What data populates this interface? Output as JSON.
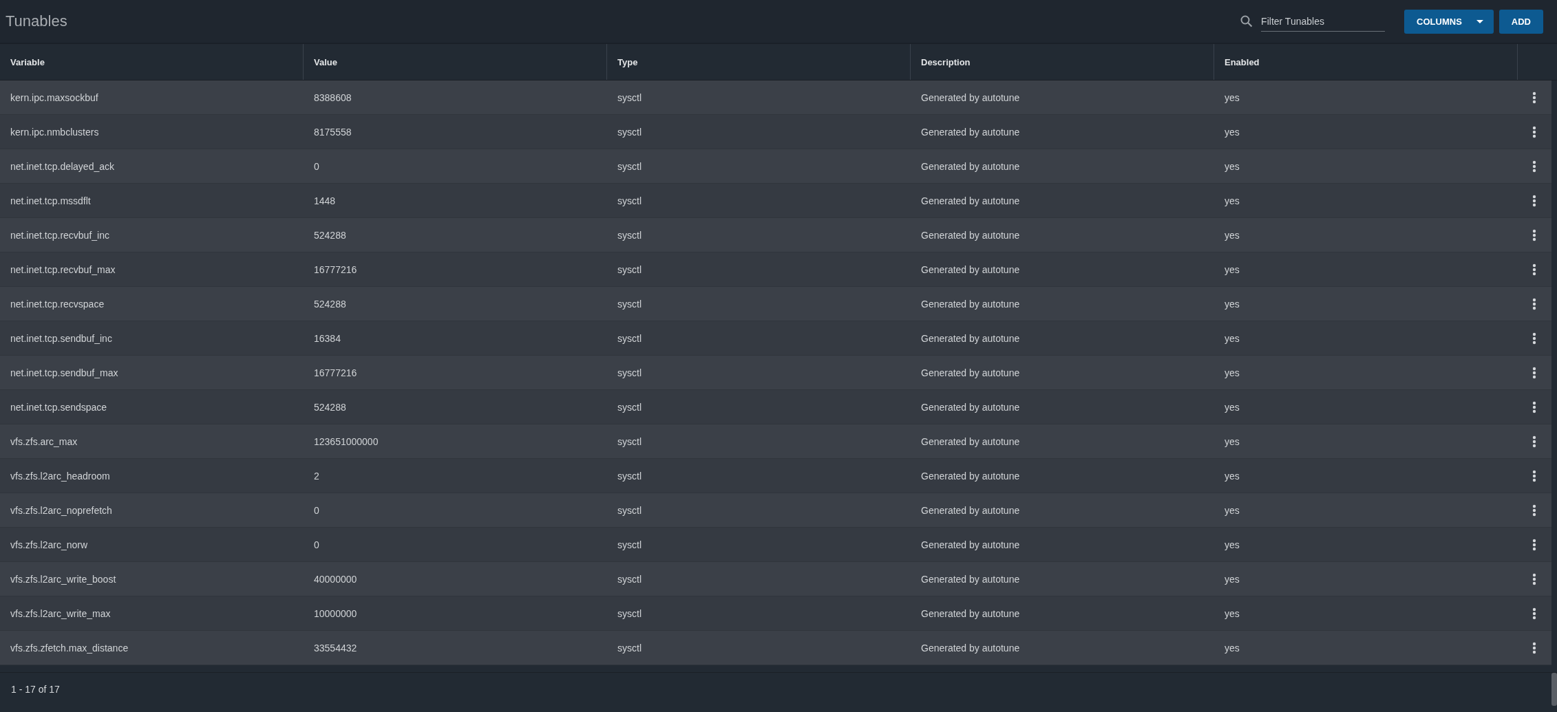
{
  "page_title": "Tunables",
  "filter": {
    "placeholder": "Filter Tunables"
  },
  "buttons": {
    "columns": "COLUMNS",
    "add": "ADD"
  },
  "table": {
    "columns": [
      "Variable",
      "Value",
      "Type",
      "Description",
      "Enabled"
    ],
    "rows": [
      [
        "kern.ipc.maxsockbuf",
        "8388608",
        "sysctl",
        "Generated by autotune",
        "yes"
      ],
      [
        "kern.ipc.nmbclusters",
        "8175558",
        "sysctl",
        "Generated by autotune",
        "yes"
      ],
      [
        "net.inet.tcp.delayed_ack",
        "0",
        "sysctl",
        "Generated by autotune",
        "yes"
      ],
      [
        "net.inet.tcp.mssdflt",
        "1448",
        "sysctl",
        "Generated by autotune",
        "yes"
      ],
      [
        "net.inet.tcp.recvbuf_inc",
        "524288",
        "sysctl",
        "Generated by autotune",
        "yes"
      ],
      [
        "net.inet.tcp.recvbuf_max",
        "16777216",
        "sysctl",
        "Generated by autotune",
        "yes"
      ],
      [
        "net.inet.tcp.recvspace",
        "524288",
        "sysctl",
        "Generated by autotune",
        "yes"
      ],
      [
        "net.inet.tcp.sendbuf_inc",
        "16384",
        "sysctl",
        "Generated by autotune",
        "yes"
      ],
      [
        "net.inet.tcp.sendbuf_max",
        "16777216",
        "sysctl",
        "Generated by autotune",
        "yes"
      ],
      [
        "net.inet.tcp.sendspace",
        "524288",
        "sysctl",
        "Generated by autotune",
        "yes"
      ],
      [
        "vfs.zfs.arc_max",
        "123651000000",
        "sysctl",
        "Generated by autotune",
        "yes"
      ],
      [
        "vfs.zfs.l2arc_headroom",
        "2",
        "sysctl",
        "Generated by autotune",
        "yes"
      ],
      [
        "vfs.zfs.l2arc_noprefetch",
        "0",
        "sysctl",
        "Generated by autotune",
        "yes"
      ],
      [
        "vfs.zfs.l2arc_norw",
        "0",
        "sysctl",
        "Generated by autotune",
        "yes"
      ],
      [
        "vfs.zfs.l2arc_write_boost",
        "40000000",
        "sysctl",
        "Generated by autotune",
        "yes"
      ],
      [
        "vfs.zfs.l2arc_write_max",
        "10000000",
        "sysctl",
        "Generated by autotune",
        "yes"
      ],
      [
        "vfs.zfs.zfetch.max_distance",
        "33554432",
        "sysctl",
        "Generated by autotune",
        "yes"
      ]
    ]
  },
  "pagination": "1 - 17 of 17"
}
